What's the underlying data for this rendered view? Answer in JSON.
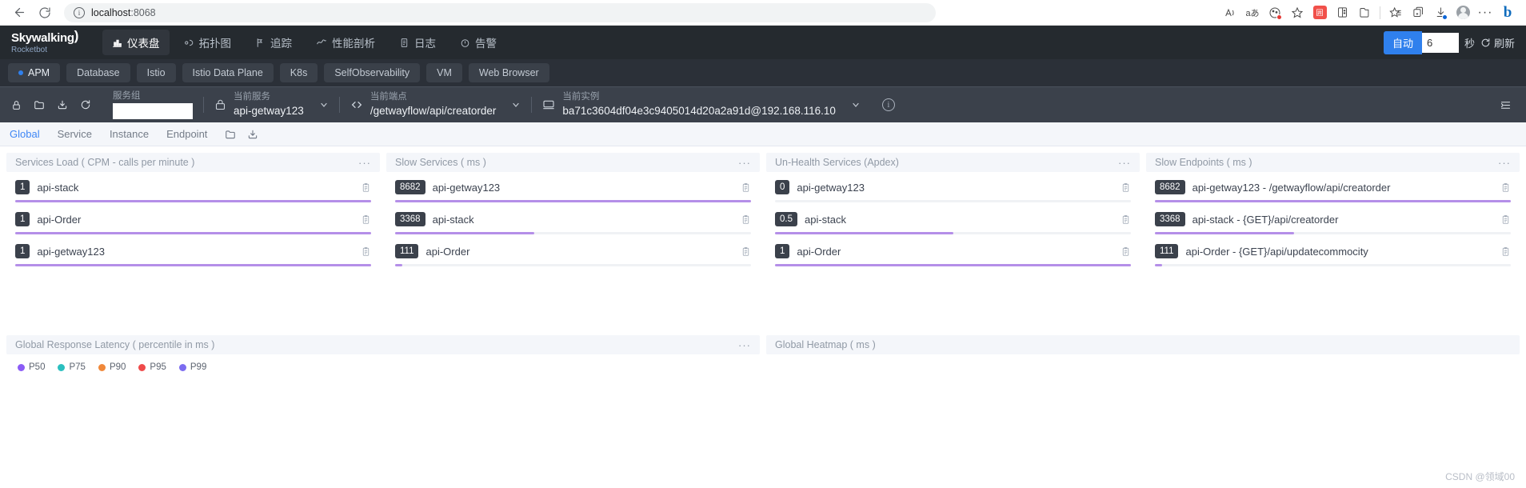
{
  "browser": {
    "url_host": "localhost",
    "url_port": ":8068",
    "back_icon": "back-arrow-icon",
    "reload_icon": "reload-icon",
    "info_icon": "info-icon",
    "toolbar_icons": [
      "read-aloud-icon",
      "translate-icon",
      "browser-essentials-icon",
      "add-favorite-icon",
      "extension-red-icon",
      "split-screen-icon",
      "collections-icon",
      "favorites-icon",
      "add-tab-icon",
      "downloads-icon",
      "profile-avatar-icon",
      "settings-more-icon",
      "copilot-icon"
    ]
  },
  "header": {
    "logo_main": "Skywalking",
    "logo_sub": "Rocketbot",
    "nav": [
      {
        "label": "仪表盘",
        "icon": "dashboard-icon",
        "active": true
      },
      {
        "label": "拓扑图",
        "icon": "topology-icon",
        "active": false
      },
      {
        "label": "追踪",
        "icon": "trace-icon",
        "active": false
      },
      {
        "label": "性能剖析",
        "icon": "profile-icon",
        "active": false
      },
      {
        "label": "日志",
        "icon": "log-icon",
        "active": false
      },
      {
        "label": "告警",
        "icon": "alarm-icon",
        "active": false
      }
    ],
    "auto_label": "自动",
    "interval_value": "6",
    "seconds_label": "秒",
    "refresh_label": "刷新",
    "refresh_icon": "refresh-icon",
    "accent_color": "#2f80ed"
  },
  "tabs": [
    {
      "label": "APM",
      "active": true
    },
    {
      "label": "Database",
      "active": false
    },
    {
      "label": "Istio",
      "active": false
    },
    {
      "label": "Istio Data Plane",
      "active": false
    },
    {
      "label": "K8s",
      "active": false
    },
    {
      "label": "SelfObservability",
      "active": false
    },
    {
      "label": "VM",
      "active": false
    },
    {
      "label": "Web Browser",
      "active": false
    }
  ],
  "toolbar": {
    "icons": [
      "lock-icon",
      "folder-icon",
      "download-icon",
      "reload-icon"
    ],
    "service_group": {
      "label": "服务组",
      "value": "",
      "placeholder": ""
    },
    "current_service": {
      "label": "当前服务",
      "value": "api-getway123",
      "icon": "service-icon"
    },
    "current_endpoint": {
      "label": "当前端点",
      "value": "/getwayflow/api/creatorder",
      "icon": "endpoint-icon"
    },
    "current_instance": {
      "label": "当前实例",
      "value": "ba71c3604df04e3c9405014d20a2a91d@192.168.116.10",
      "icon": "instance-icon"
    },
    "info_icon": "info-icon",
    "expand_icon": "expand-panel-icon"
  },
  "subtabs": {
    "items": [
      {
        "label": "Global",
        "active": true
      },
      {
        "label": "Service",
        "active": false
      },
      {
        "label": "Instance",
        "active": false
      },
      {
        "label": "Endpoint",
        "active": false
      }
    ],
    "icons": [
      "folder-icon",
      "download-icon"
    ]
  },
  "chart_data": [
    {
      "type": "bar",
      "title": "Services Load ( CPM - calls per minute )",
      "orientation": "horizontal",
      "categories": [
        "api-stack",
        "api-Order",
        "api-getway123"
      ],
      "values": [
        1,
        1,
        1
      ],
      "max": 1,
      "bar_color": "#b58fe8",
      "rows": [
        {
          "value": "1",
          "name": "api-stack",
          "pct": 100
        },
        {
          "value": "1",
          "name": "api-Order",
          "pct": 100
        },
        {
          "value": "1",
          "name": "api-getway123",
          "pct": 100
        }
      ]
    },
    {
      "type": "bar",
      "title": "Slow Services ( ms )",
      "orientation": "horizontal",
      "categories": [
        "api-getway123",
        "api-stack",
        "api-Order"
      ],
      "values": [
        8682,
        3368,
        111
      ],
      "max": 8682,
      "bar_color": "#b58fe8",
      "rows": [
        {
          "value": "8682",
          "name": "api-getway123",
          "pct": 100
        },
        {
          "value": "3368",
          "name": "api-stack",
          "pct": 39
        },
        {
          "value": "111",
          "name": "api-Order",
          "pct": 2
        }
      ]
    },
    {
      "type": "bar",
      "title": "Un-Health Services (Apdex)",
      "orientation": "horizontal",
      "categories": [
        "api-getway123",
        "api-stack",
        "api-Order"
      ],
      "values": [
        0,
        0.5,
        1
      ],
      "max": 1,
      "bar_color": "#b58fe8",
      "rows": [
        {
          "value": "0",
          "name": "api-getway123",
          "pct": 0
        },
        {
          "value": "0.5",
          "name": "api-stack",
          "pct": 50
        },
        {
          "value": "1",
          "name": "api-Order",
          "pct": 100
        }
      ]
    },
    {
      "type": "bar",
      "title": "Slow Endpoints ( ms )",
      "orientation": "horizontal",
      "categories": [
        "api-getway123 - /getwayflow/api/creatorder",
        "api-stack - {GET}/api/creatorder",
        "api-Order - {GET}/api/updatecommocity"
      ],
      "values": [
        8682,
        3368,
        111
      ],
      "max": 8682,
      "bar_color": "#b58fe8",
      "rows": [
        {
          "value": "8682",
          "name": "api-getway123 - /getwayflow/api/creatorder",
          "pct": 100
        },
        {
          "value": "3368",
          "name": "api-stack - {GET}/api/creatorder",
          "pct": 39
        },
        {
          "value": "111",
          "name": "api-Order - {GET}/api/updatecommocity",
          "pct": 2
        }
      ]
    },
    {
      "type": "line",
      "title": "Global Response Latency ( percentile in ms )",
      "legend_position": "bottom",
      "series": [
        {
          "name": "P50",
          "color": "#8b5cf6"
        },
        {
          "name": "P75",
          "color": "#2bbfbf"
        },
        {
          "name": "P90",
          "color": "#f0883a"
        },
        {
          "name": "P95",
          "color": "#ef4a4a"
        },
        {
          "name": "P99",
          "color": "#7c6cf0"
        }
      ]
    },
    {
      "type": "heatmap",
      "title": "Global Heatmap ( ms )"
    }
  ],
  "panels": {
    "dots_label": "•••"
  },
  "watermark": "CSDN @领域00"
}
